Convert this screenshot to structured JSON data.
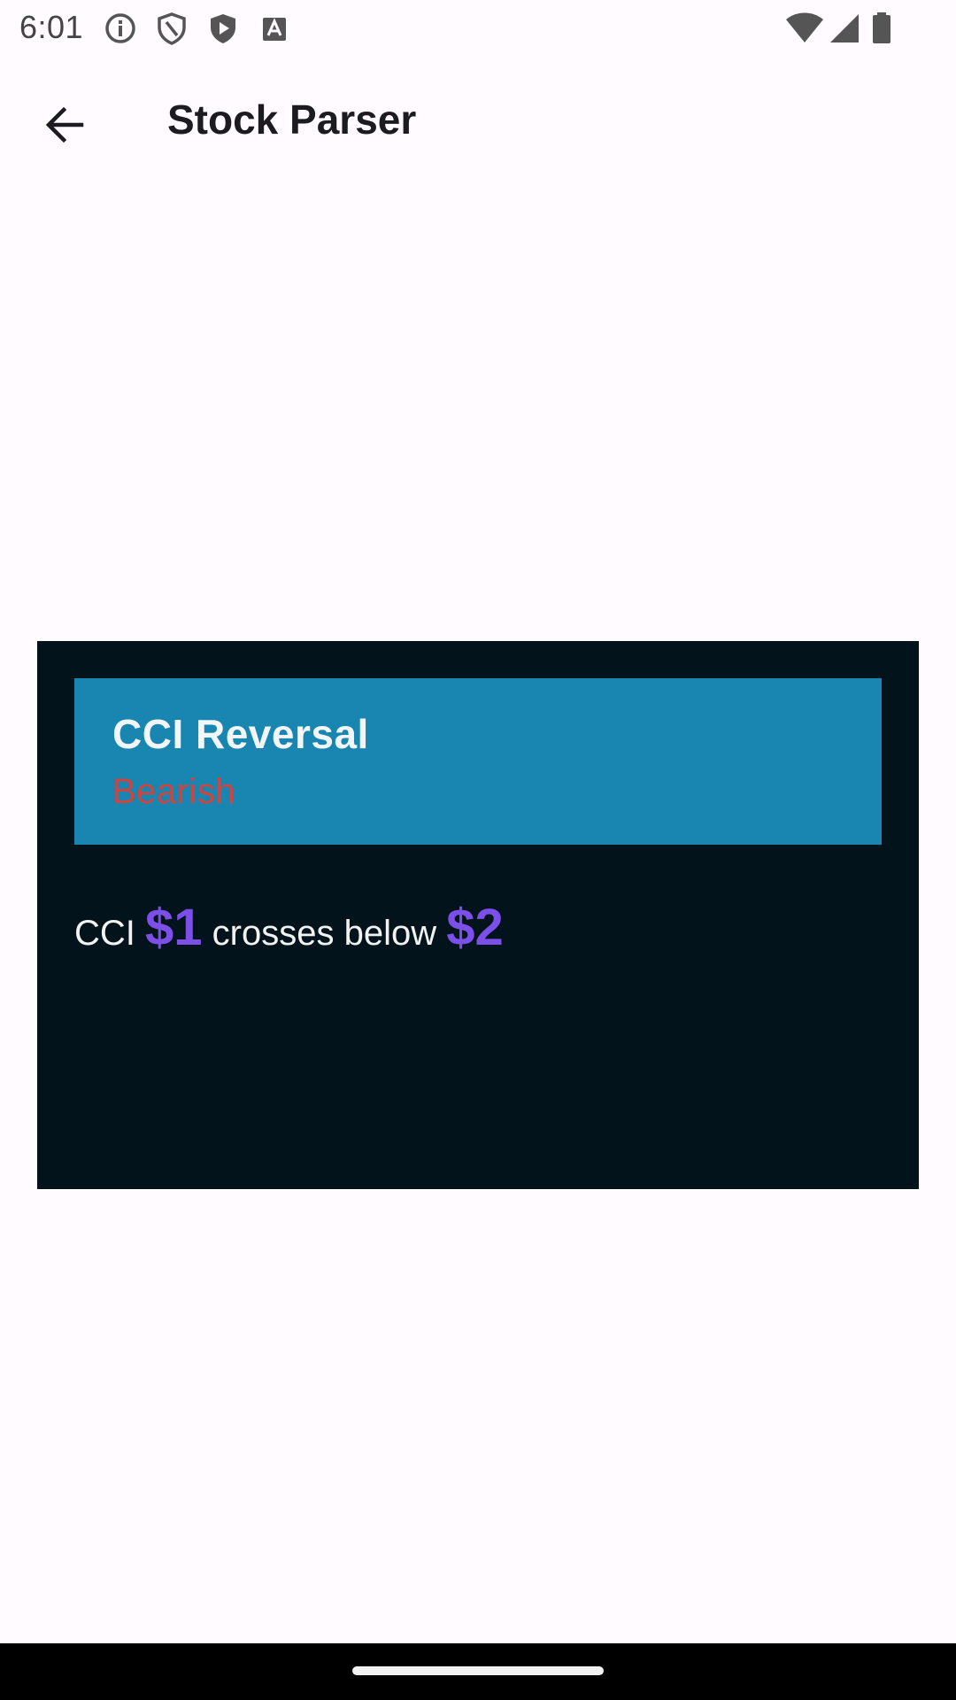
{
  "status_bar": {
    "time": "6:01",
    "icons": [
      "info-icon",
      "shield-icon",
      "play-shield-icon",
      "keyboard-a-icon",
      "wifi-icon",
      "signal-icon",
      "battery-icon"
    ]
  },
  "app_bar": {
    "title": "Stock Parser",
    "back_icon": "arrow-back-icon"
  },
  "card": {
    "title": "CCI Reversal",
    "subtitle": "Bearish",
    "body": {
      "prefix": "CCI",
      "var1": "$1",
      "middle": "crosses below",
      "var2": "$2"
    }
  },
  "colors": {
    "background": "#fffbfe",
    "card_bg": "#02131c",
    "header_bg": "#1886b1",
    "bearish": "#d2433e",
    "variable": "#7b4fe8"
  }
}
